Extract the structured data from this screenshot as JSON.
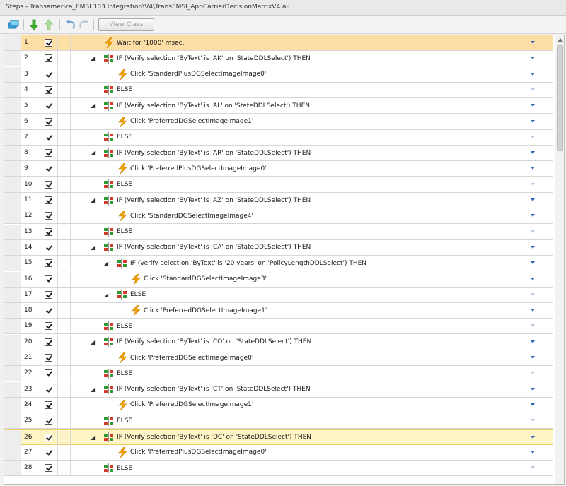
{
  "window": {
    "title": "Steps - Transamerica_EMSI 103 Integration\\V4\\TransEMSI_AppCarrierDecisionMatrixV4.aii"
  },
  "toolbar": {
    "view_class_label": "View Class",
    "icons": [
      "step-properties-icon",
      "move-down-icon",
      "move-up-icon",
      "undo-icon",
      "redo-icon"
    ]
  },
  "colors": {
    "selected_row": "#fddfa5",
    "highlight_row": "#fff4c6",
    "lightning": "#f0a400",
    "dropdown_arrow": "#2a63b8"
  },
  "steps": [
    {
      "num": "1",
      "checked": true,
      "indent": 0,
      "toggle": "",
      "icon": "lightning-icon",
      "label": "Wait for '1000' msec.",
      "selected": true
    },
    {
      "num": "2",
      "checked": true,
      "indent": 0,
      "toggle": "◢",
      "icon": "branch-icon",
      "label": "IF (Verify selection 'ByText' is 'AK' on 'StateDDLSelect') THEN"
    },
    {
      "num": "3",
      "checked": true,
      "indent": 1,
      "toggle": "",
      "icon": "lightning-icon",
      "label": "Click 'StandardPlusDGSelectImageImage0'"
    },
    {
      "num": "4",
      "checked": true,
      "indent": 0,
      "toggle": "",
      "icon": "branch-icon",
      "label": "ELSE"
    },
    {
      "num": "5",
      "checked": true,
      "indent": 0,
      "toggle": "◢",
      "icon": "branch-icon",
      "label": "IF (Verify selection 'ByText' is 'AL' on 'StateDDLSelect') THEN"
    },
    {
      "num": "6",
      "checked": true,
      "indent": 1,
      "toggle": "",
      "icon": "lightning-icon",
      "label": "Click 'PreferredDGSelectImageImage1'"
    },
    {
      "num": "7",
      "checked": true,
      "indent": 0,
      "toggle": "",
      "icon": "branch-icon",
      "label": "ELSE"
    },
    {
      "num": "8",
      "checked": true,
      "indent": 0,
      "toggle": "◢",
      "icon": "branch-icon",
      "label": "IF (Verify selection 'ByText' is 'AR' on 'StateDDLSelect') THEN"
    },
    {
      "num": "9",
      "checked": true,
      "indent": 1,
      "toggle": "",
      "icon": "lightning-icon",
      "label": "Click 'PreferredPlusDGSelectImageImage0'"
    },
    {
      "num": "10",
      "checked": true,
      "indent": 0,
      "toggle": "",
      "icon": "branch-icon",
      "label": "ELSE"
    },
    {
      "num": "11",
      "checked": true,
      "indent": 0,
      "toggle": "◢",
      "icon": "branch-icon",
      "label": "IF (Verify selection 'ByText' is 'AZ' on 'StateDDLSelect') THEN"
    },
    {
      "num": "12",
      "checked": true,
      "indent": 1,
      "toggle": "",
      "icon": "lightning-icon",
      "label": "Click 'StandardDGSelectImageImage4'"
    },
    {
      "num": "13",
      "checked": true,
      "indent": 0,
      "toggle": "",
      "icon": "branch-icon",
      "label": "ELSE"
    },
    {
      "num": "14",
      "checked": true,
      "indent": 0,
      "toggle": "◢",
      "icon": "branch-icon",
      "label": "IF (Verify selection 'ByText' is 'CA' on 'StateDDLSelect') THEN"
    },
    {
      "num": "15",
      "checked": true,
      "indent": 1,
      "toggle": "◢",
      "icon": "branch-icon",
      "label": "IF (Verify selection 'ByText' is '20 years' on 'PolicyLengthDDLSelect') THEN"
    },
    {
      "num": "16",
      "checked": true,
      "indent": 2,
      "toggle": "",
      "icon": "lightning-icon",
      "label": "Click 'StandardDGSelectImageImage3'"
    },
    {
      "num": "17",
      "checked": true,
      "indent": 1,
      "toggle": "◢",
      "icon": "branch-icon",
      "label": "ELSE"
    },
    {
      "num": "18",
      "checked": true,
      "indent": 2,
      "toggle": "",
      "icon": "lightning-icon",
      "label": "Click 'PreferredDGSelectImageImage1'"
    },
    {
      "num": "19",
      "checked": true,
      "indent": 0,
      "toggle": "",
      "icon": "branch-icon",
      "label": "ELSE"
    },
    {
      "num": "20",
      "checked": true,
      "indent": 0,
      "toggle": "◢",
      "icon": "branch-icon",
      "label": "IF (Verify selection 'ByText' is 'CO' on 'StateDDLSelect') THEN"
    },
    {
      "num": "21",
      "checked": true,
      "indent": 1,
      "toggle": "",
      "icon": "lightning-icon",
      "label": "Click 'PreferredDGSelectImageImage0'"
    },
    {
      "num": "22",
      "checked": true,
      "indent": 0,
      "toggle": "",
      "icon": "branch-icon",
      "label": "ELSE"
    },
    {
      "num": "23",
      "checked": true,
      "indent": 0,
      "toggle": "◢",
      "icon": "branch-icon",
      "label": "IF (Verify selection 'ByText' is 'CT' on 'StateDDLSelect') THEN"
    },
    {
      "num": "24",
      "checked": true,
      "indent": 1,
      "toggle": "",
      "icon": "lightning-icon",
      "label": "Click 'PreferredDGSelectImageImage1'"
    },
    {
      "num": "25",
      "checked": true,
      "indent": 0,
      "toggle": "",
      "icon": "branch-icon",
      "label": "ELSE"
    },
    {
      "num": "26",
      "checked": true,
      "indent": 0,
      "toggle": "◢",
      "icon": "branch-icon",
      "label": "IF (Verify selection 'ByText' is 'DC' on 'StateDDLSelect') THEN",
      "highlighted": true
    },
    {
      "num": "27",
      "checked": true,
      "indent": 1,
      "toggle": "",
      "icon": "lightning-icon",
      "label": "Click 'PreferredPlusDGSelectImageImage0'"
    },
    {
      "num": "28",
      "checked": true,
      "indent": 0,
      "toggle": "",
      "icon": "branch-icon",
      "label": "ELSE"
    }
  ]
}
